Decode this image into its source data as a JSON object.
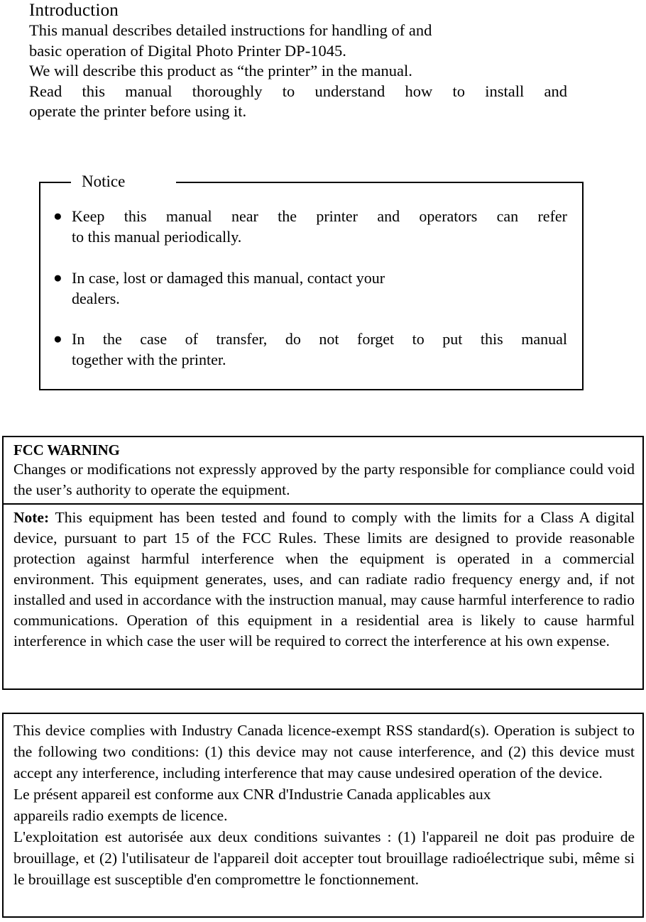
{
  "intro": {
    "title": "Introduction",
    "lines": [
      "This manual describes detailed instructions for handling of and",
      "basic operation of Digital Photo Printer DP-1045.",
      "We will describe this product as “the printer” in the manual.",
      "Read this manual thoroughly to understand how to install and",
      "operate the printer before using it."
    ]
  },
  "notice": {
    "legend": "Notice",
    "bullet_glyph": "●",
    "items": [
      {
        "line1": "Keep this manual near the printer and operators can refer",
        "line2": "to this manual periodically."
      },
      {
        "line1": "In case, lost or damaged this manual, contact your",
        "line2": "dealers."
      },
      {
        "line1": "In the case of transfer, do not forget to put this manual",
        "line2": "together with the printer."
      }
    ]
  },
  "fcc": {
    "warning_title": "FCC WARNING",
    "warning_body": "Changes or modifications not expressly approved by the party responsible for compliance could void the user’s authority to operate the equipment.",
    "note_label": "Note:",
    "note_body": " This equipment has been tested and found to comply with the limits for a Class A digital device, pursuant to part 15 of the FCC Rules. These limits are designed to provide reasonable protection against harmful interference when the equipment is operated in a commercial environment. This equipment generates, uses, and can radiate radio frequency energy and, if not installed and used in accordance with the instruction manual, may cause harmful interference to radio communications. Operation of this equipment in a residential area is likely to cause harmful interference in which case the user will be required to correct the interference at his own expense."
  },
  "industry_canada": {
    "para_en": "This device complies with Industry Canada licence-exempt RSS standard(s). Operation is subject to the following two conditions: (1) this device may not cause interference, and (2) this device must accept any interference, including interference that may cause undesired operation of the device.",
    "para_fr_1_line1": "Le présent appareil est conforme aux CNR d'Industrie Canada applicables aux",
    "para_fr_1_line2": "appareils radio exempts de licence.",
    "para_fr_2": "L'exploitation est autorisée aux deux conditions suivantes : (1) l'appareil ne doit pas produire de brouillage, et (2) l'utilisateur de l'appareil doit accepter tout brouillage radioélectrique subi, même si le brouillage est susceptible d'en compromettre le fonctionnement."
  },
  "colors": {
    "text": "#000000",
    "border": "#000000",
    "page_background": "#ffffff"
  }
}
